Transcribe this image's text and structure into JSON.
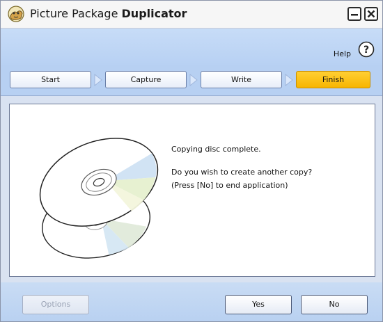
{
  "window": {
    "title_regular": "Picture Package ",
    "title_bold": "Duplicator",
    "icon": "picture-package-app-icon",
    "minimize_icon": "minimize-icon",
    "close_icon": "close-icon"
  },
  "help": {
    "label": "Help",
    "icon": "help-question-icon"
  },
  "steps": [
    {
      "label": "Start",
      "active": false
    },
    {
      "label": "Capture",
      "active": false
    },
    {
      "label": "Write",
      "active": false
    },
    {
      "label": "Finish",
      "active": true
    }
  ],
  "message": {
    "status": "Copying disc complete.",
    "question": "Do you wish to create another copy?",
    "hint": "(Press [No] to end application)"
  },
  "buttons": {
    "options": "Options",
    "yes": "Yes",
    "no": "No"
  },
  "colors": {
    "active_step": "#f7b500",
    "accent_blue": "#b7d0f2"
  }
}
